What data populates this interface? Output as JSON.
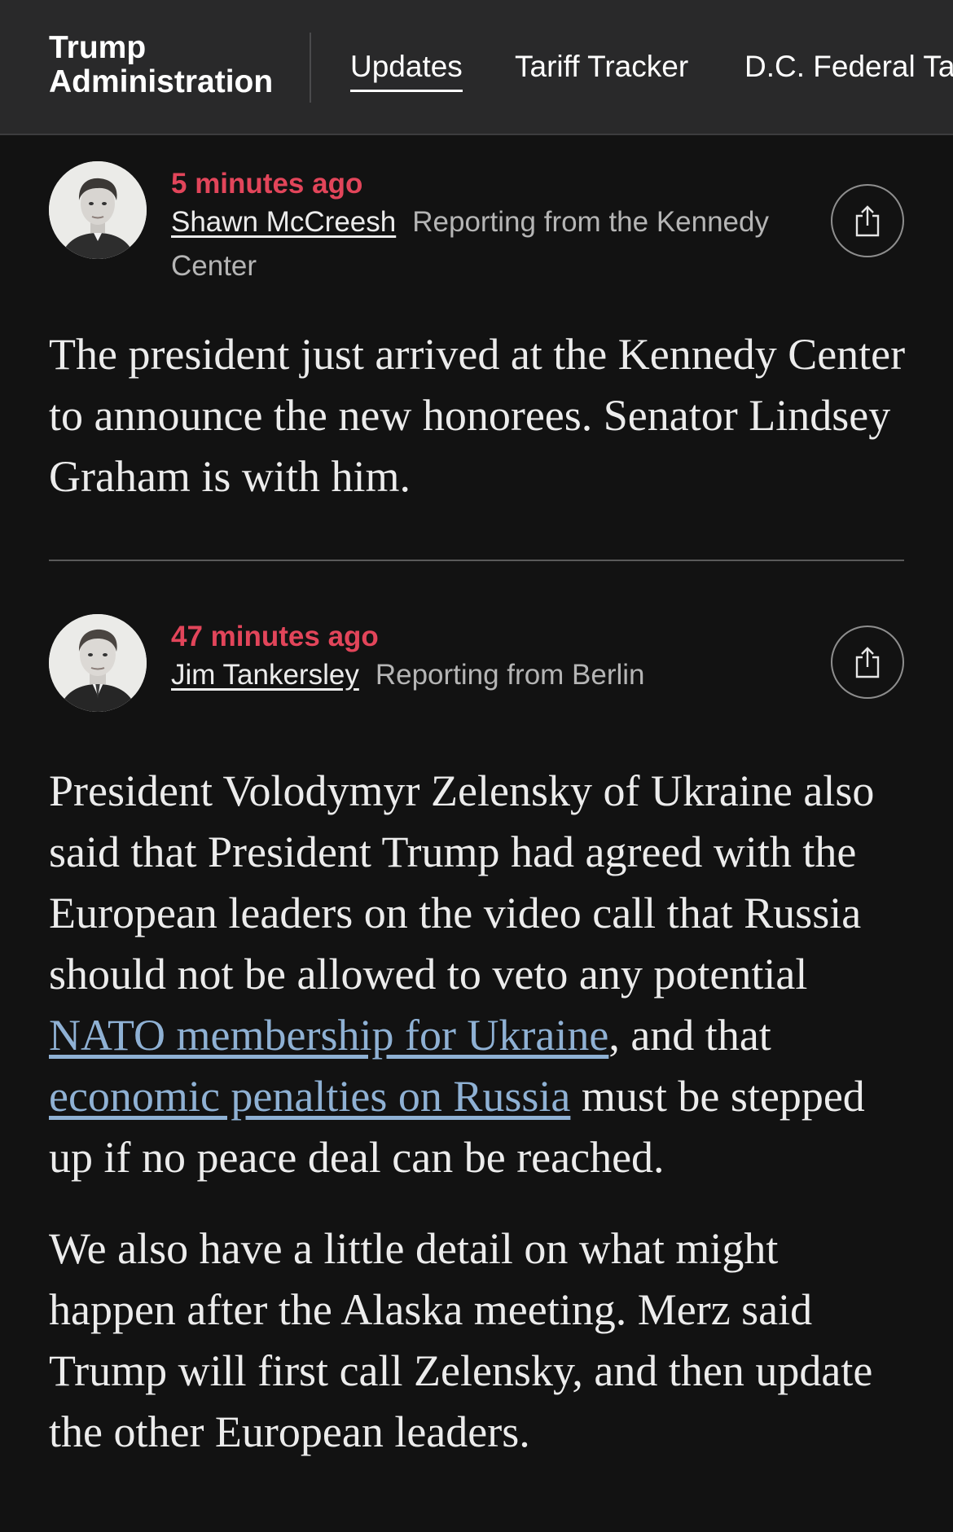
{
  "nav": {
    "section_title_line1": "Trump",
    "section_title_line2": "Administration",
    "tabs": [
      {
        "label": "Updates",
        "active": true
      },
      {
        "label": "Tariff Tracker",
        "active": false
      },
      {
        "label": "D.C. Federal Ta",
        "active": false
      }
    ]
  },
  "posts": [
    {
      "time_ago": "5 minutes ago",
      "author": "Shawn McCreesh",
      "location": "Reporting from the Kennedy Center",
      "avatar_icon": "person-portrait-icon",
      "share_icon": "share-icon",
      "body": [
        "The president just arrived at the Kennedy Center to announce the new honorees. Senator Lindsey Graham is with him."
      ]
    },
    {
      "time_ago": "47 minutes ago",
      "author": "Jim Tankersley",
      "location": "Reporting from Berlin",
      "avatar_icon": "person-portrait-icon",
      "share_icon": "share-icon",
      "body_p1": {
        "text_a": "President Volodymyr Zelensky of Ukraine also said that President Trump had agreed with the European leaders on the video call that Russia should not be allowed to veto any potential ",
        "link_1": "NATO membership for Ukraine",
        "text_b": ", and that ",
        "link_2": "economic penalties on Russia",
        "text_c": " must be stepped up if no peace deal can be reached."
      },
      "body_p2": "We also have a little detail on what might happen after the Alaska meeting. Merz said Trump will first call Zelensky, and then update the other European leaders."
    }
  ],
  "colors": {
    "background": "#121212",
    "topbar": "#29292a",
    "timestamp": "#e2455a",
    "link": "#8fb1d4",
    "text": "#ececec",
    "muted": "#b5b5b5"
  }
}
